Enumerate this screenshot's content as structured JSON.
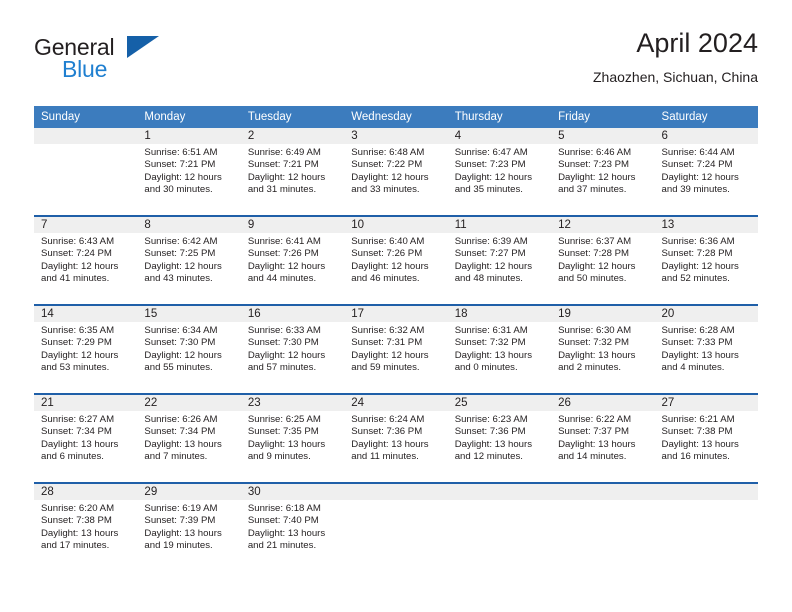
{
  "brand": {
    "name_part1": "General",
    "name_part2": "Blue",
    "triangle_color": "#1560a8",
    "blue_text_color": "#1f7fd0"
  },
  "header": {
    "title": "April 2024",
    "location": "Zhaozhen, Sichuan, China"
  },
  "theme": {
    "header_blue": "#3c7cbe",
    "separator_blue": "#1f5fa8",
    "daynum_band": "#efefef",
    "text": "#231f20"
  },
  "calendar": {
    "weekday_headers": [
      "Sunday",
      "Monday",
      "Tuesday",
      "Wednesday",
      "Thursday",
      "Friday",
      "Saturday"
    ],
    "weeks": [
      [
        {
          "day": "",
          "lines": []
        },
        {
          "day": "1",
          "lines": [
            "Sunrise: 6:51 AM",
            "Sunset: 7:21 PM",
            "Daylight: 12 hours",
            "and 30 minutes."
          ]
        },
        {
          "day": "2",
          "lines": [
            "Sunrise: 6:49 AM",
            "Sunset: 7:21 PM",
            "Daylight: 12 hours",
            "and 31 minutes."
          ]
        },
        {
          "day": "3",
          "lines": [
            "Sunrise: 6:48 AM",
            "Sunset: 7:22 PM",
            "Daylight: 12 hours",
            "and 33 minutes."
          ]
        },
        {
          "day": "4",
          "lines": [
            "Sunrise: 6:47 AM",
            "Sunset: 7:23 PM",
            "Daylight: 12 hours",
            "and 35 minutes."
          ]
        },
        {
          "day": "5",
          "lines": [
            "Sunrise: 6:46 AM",
            "Sunset: 7:23 PM",
            "Daylight: 12 hours",
            "and 37 minutes."
          ]
        },
        {
          "day": "6",
          "lines": [
            "Sunrise: 6:44 AM",
            "Sunset: 7:24 PM",
            "Daylight: 12 hours",
            "and 39 minutes."
          ]
        }
      ],
      [
        {
          "day": "7",
          "lines": [
            "Sunrise: 6:43 AM",
            "Sunset: 7:24 PM",
            "Daylight: 12 hours",
            "and 41 minutes."
          ]
        },
        {
          "day": "8",
          "lines": [
            "Sunrise: 6:42 AM",
            "Sunset: 7:25 PM",
            "Daylight: 12 hours",
            "and 43 minutes."
          ]
        },
        {
          "day": "9",
          "lines": [
            "Sunrise: 6:41 AM",
            "Sunset: 7:26 PM",
            "Daylight: 12 hours",
            "and 44 minutes."
          ]
        },
        {
          "day": "10",
          "lines": [
            "Sunrise: 6:40 AM",
            "Sunset: 7:26 PM",
            "Daylight: 12 hours",
            "and 46 minutes."
          ]
        },
        {
          "day": "11",
          "lines": [
            "Sunrise: 6:39 AM",
            "Sunset: 7:27 PM",
            "Daylight: 12 hours",
            "and 48 minutes."
          ]
        },
        {
          "day": "12",
          "lines": [
            "Sunrise: 6:37 AM",
            "Sunset: 7:28 PM",
            "Daylight: 12 hours",
            "and 50 minutes."
          ]
        },
        {
          "day": "13",
          "lines": [
            "Sunrise: 6:36 AM",
            "Sunset: 7:28 PM",
            "Daylight: 12 hours",
            "and 52 minutes."
          ]
        }
      ],
      [
        {
          "day": "14",
          "lines": [
            "Sunrise: 6:35 AM",
            "Sunset: 7:29 PM",
            "Daylight: 12 hours",
            "and 53 minutes."
          ]
        },
        {
          "day": "15",
          "lines": [
            "Sunrise: 6:34 AM",
            "Sunset: 7:30 PM",
            "Daylight: 12 hours",
            "and 55 minutes."
          ]
        },
        {
          "day": "16",
          "lines": [
            "Sunrise: 6:33 AM",
            "Sunset: 7:30 PM",
            "Daylight: 12 hours",
            "and 57 minutes."
          ]
        },
        {
          "day": "17",
          "lines": [
            "Sunrise: 6:32 AM",
            "Sunset: 7:31 PM",
            "Daylight: 12 hours",
            "and 59 minutes."
          ]
        },
        {
          "day": "18",
          "lines": [
            "Sunrise: 6:31 AM",
            "Sunset: 7:32 PM",
            "Daylight: 13 hours",
            "and 0 minutes."
          ]
        },
        {
          "day": "19",
          "lines": [
            "Sunrise: 6:30 AM",
            "Sunset: 7:32 PM",
            "Daylight: 13 hours",
            "and 2 minutes."
          ]
        },
        {
          "day": "20",
          "lines": [
            "Sunrise: 6:28 AM",
            "Sunset: 7:33 PM",
            "Daylight: 13 hours",
            "and 4 minutes."
          ]
        }
      ],
      [
        {
          "day": "21",
          "lines": [
            "Sunrise: 6:27 AM",
            "Sunset: 7:34 PM",
            "Daylight: 13 hours",
            "and 6 minutes."
          ]
        },
        {
          "day": "22",
          "lines": [
            "Sunrise: 6:26 AM",
            "Sunset: 7:34 PM",
            "Daylight: 13 hours",
            "and 7 minutes."
          ]
        },
        {
          "day": "23",
          "lines": [
            "Sunrise: 6:25 AM",
            "Sunset: 7:35 PM",
            "Daylight: 13 hours",
            "and 9 minutes."
          ]
        },
        {
          "day": "24",
          "lines": [
            "Sunrise: 6:24 AM",
            "Sunset: 7:36 PM",
            "Daylight: 13 hours",
            "and 11 minutes."
          ]
        },
        {
          "day": "25",
          "lines": [
            "Sunrise: 6:23 AM",
            "Sunset: 7:36 PM",
            "Daylight: 13 hours",
            "and 12 minutes."
          ]
        },
        {
          "day": "26",
          "lines": [
            "Sunrise: 6:22 AM",
            "Sunset: 7:37 PM",
            "Daylight: 13 hours",
            "and 14 minutes."
          ]
        },
        {
          "day": "27",
          "lines": [
            "Sunrise: 6:21 AM",
            "Sunset: 7:38 PM",
            "Daylight: 13 hours",
            "and 16 minutes."
          ]
        }
      ],
      [
        {
          "day": "28",
          "lines": [
            "Sunrise: 6:20 AM",
            "Sunset: 7:38 PM",
            "Daylight: 13 hours",
            "and 17 minutes."
          ]
        },
        {
          "day": "29",
          "lines": [
            "Sunrise: 6:19 AM",
            "Sunset: 7:39 PM",
            "Daylight: 13 hours",
            "and 19 minutes."
          ]
        },
        {
          "day": "30",
          "lines": [
            "Sunrise: 6:18 AM",
            "Sunset: 7:40 PM",
            "Daylight: 13 hours",
            "and 21 minutes."
          ]
        },
        {
          "day": "",
          "lines": []
        },
        {
          "day": "",
          "lines": []
        },
        {
          "day": "",
          "lines": []
        },
        {
          "day": "",
          "lines": []
        }
      ]
    ]
  }
}
